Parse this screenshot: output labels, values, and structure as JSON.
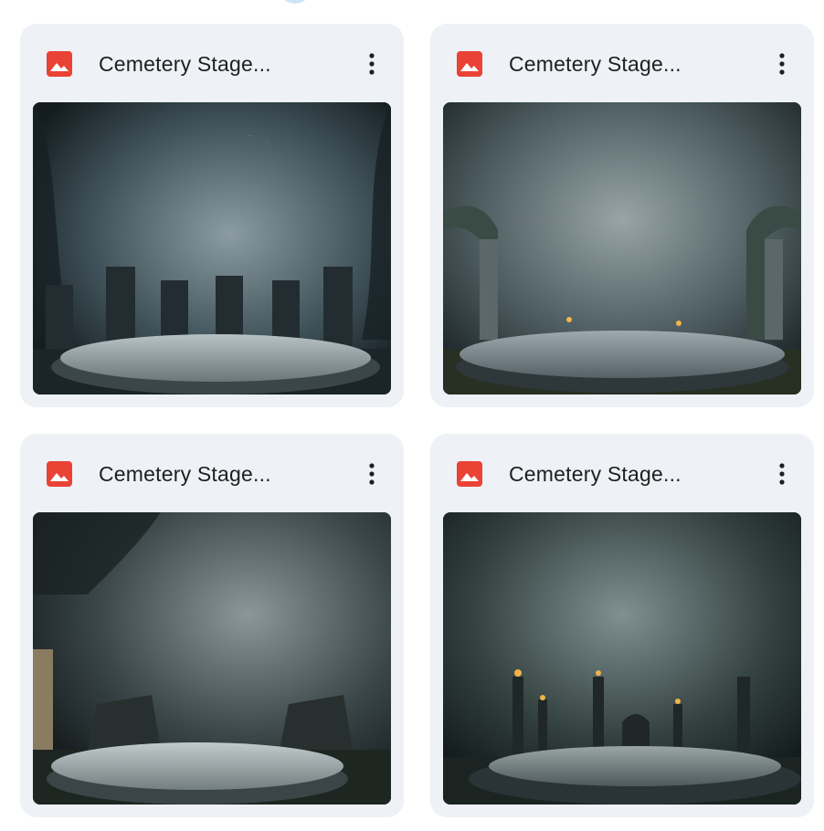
{
  "files": [
    {
      "name": "Cemetery Stage...",
      "icon": "image-file-icon",
      "menu_icon": "more-vert-icon",
      "scene": "tombstones-moon"
    },
    {
      "name": "Cemetery Stage...",
      "icon": "image-file-icon",
      "menu_icon": "more-vert-icon",
      "scene": "arches-candles"
    },
    {
      "name": "Cemetery Stage...",
      "icon": "image-file-icon",
      "menu_icon": "more-vert-icon",
      "scene": "ruins-fog"
    },
    {
      "name": "Cemetery Stage...",
      "icon": "image-file-icon",
      "menu_icon": "more-vert-icon",
      "scene": "spires-candles"
    }
  ],
  "colors": {
    "card_bg": "#eef1f6",
    "file_icon": "#ea4335",
    "text": "#1f1f1f"
  }
}
